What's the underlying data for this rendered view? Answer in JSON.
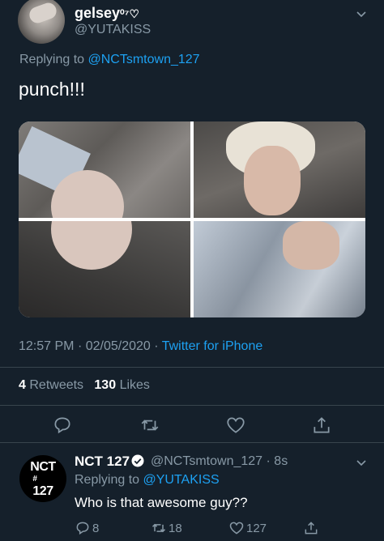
{
  "tweet": {
    "author_name": "gelsey",
    "author_name_suffix": "⁰⁷♡",
    "author_handle": "@YUTAKISS",
    "replying_prefix": "Replying to ",
    "replying_to": "@NCTsmtown_127",
    "text": "punch!!!",
    "time": "12:57 PM",
    "date": "02/05/2020",
    "separator": "·",
    "source": "Twitter for iPhone",
    "retweets_count": "4",
    "retweets_label": "Retweets",
    "likes_count": "130",
    "likes_label": "Likes"
  },
  "reply": {
    "avatar_text_top": "NCT",
    "avatar_text_bottom": "127",
    "avatar_text_hash": "#",
    "author_name": "NCT 127",
    "author_handle": "@NCTsmtown_127",
    "time_ago": "· 8s",
    "replying_prefix": "Replying to ",
    "replying_to": "@YUTAKISS",
    "text": "Who is that awesome guy??",
    "reply_count": "8",
    "retweet_count": "18",
    "like_count": "127"
  },
  "colors": {
    "background": "#15202b",
    "accent": "#1da1f2",
    "secondary_text": "#8899a6",
    "divider": "#38444d"
  },
  "icons": [
    "chevron-down-icon",
    "reply-icon",
    "retweet-icon",
    "like-icon",
    "share-icon",
    "verified-badge-icon"
  ]
}
